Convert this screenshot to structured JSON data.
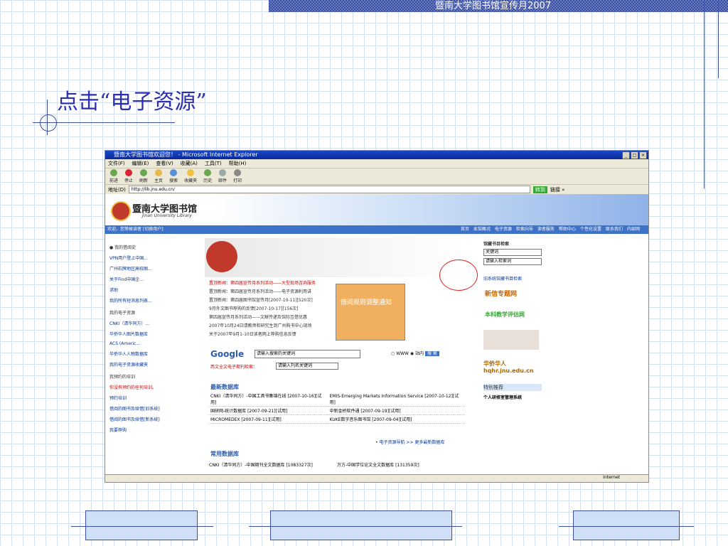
{
  "slide": {
    "header": "暨南大学图书馆宣传月2007",
    "title": "点击“电子资源”"
  },
  "browser": {
    "window_title": "暨南大学图书馆欢迎您！ - Microsoft Internet Explorer",
    "menu": [
      "文件(F)",
      "编辑(E)",
      "查看(V)",
      "收藏(A)",
      "工具(T)",
      "帮助(H)"
    ],
    "toolbar": [
      "前进",
      "停止",
      "刷新",
      "主页",
      "搜索",
      "收藏夹",
      "历史",
      "邮件",
      "打印"
    ],
    "address_label": "地址(D)",
    "url": "http://lib.jnu.edu.cn/",
    "go_label": "转到",
    "links_label": "链接 »",
    "status_zone": "Internet"
  },
  "site": {
    "name": "暨南大学图书馆",
    "subtitle": "Jinan University Library",
    "nav_left": "欢迎，您等候读者 [切换用户]",
    "nav_right": [
      "首页",
      "本馆概况",
      "电子资源",
      "检索向导",
      "读者服务",
      "帮助中心",
      "个性化设置",
      "联系我们",
      "内部网"
    ],
    "left_items": [
      "我的借阅史",
      "VPN用户登上中国...",
      "广州石牌地区高校图...",
      "关于Find中国企...",
      "求助",
      "我的所有短消息列表..."
    ],
    "left_head2": "我的电子资源",
    "left_items2": [
      "CNKI（清华同方）...",
      "华侨华人图片数据库",
      "ACS (Americ...",
      "华侨华人人物数据库",
      "我的电子资源收藏夹"
    ],
    "left_head3": "我预约的培训",
    "left_items3": [
      "你没有预约的任何培训。",
      "预约培训"
    ],
    "left_items4": [
      "借阅的图书及续借[旧系统]",
      "借阅的图书及续借[新系统]",
      "我要荐购"
    ],
    "news": [
      "置顶新闻：第四届宣传月系列活动——大型现场咨询服务",
      "置顶新闻：第四届宣传月系列活动——电子资源利用讲",
      "置顶新闻：第四届图书馆宣传月[2007-10-11][520次]",
      "9月外文图书荐购的反馈[2007-10-17][156次]",
      "第四届宣传月系列活动——文献传递及馆际互借优惠",
      "2007年10月24日请教师和研究生到广州购书中心现场",
      "关于2007年9月1-10日读者网上荐购信息反馈"
    ],
    "popup_title": "借阅规则调整通知",
    "google_label": "Google",
    "search_placeholder": "请输入搜索的关键词",
    "radio_www": "WWW",
    "radio_site": "站内",
    "search_btn": "搜 索",
    "journal_label": "西文全文电子期刊检索：",
    "journal_placeholder": "请输入刊名关键词",
    "new_db_title": "最新数据库",
    "new_db_rows": [
      [
        "CNKI（清华同方）-中国工具书集锦在线 [2007-10-16][试用]",
        "EMIS-Emerging Markets Information Service [2007-10-12][试用]"
      ],
      [
        "国研网-统计数据库 [2007-09-21][试用]",
        "中新金桥软件通 [2007-09-19][试用]"
      ],
      [
        "MICROMEDEX [2007-09-11][试用]",
        "KUKE数字音乐图书馆 [2007-09-04][试用]"
      ]
    ],
    "db_nav": "• 电子资源导航 >> 更多最新数据库",
    "common_db_title": "常用数据库",
    "common_db_row": [
      "CNKI（清华同方）-中国期刊全文数据库 [1083327次]",
      "万方-中国学位论文全文数据库 [131359次]"
    ],
    "right_title": "馆藏书目检索",
    "right_select": "关键词",
    "right_input": "请输入检索词",
    "right_link": "旧系统馆藏书目检索",
    "right_promo1": "新信专题网",
    "right_promo2": "本科教学评估网",
    "right_promo3": "华侨华人 hqhr.jnu.edu.cn",
    "right_box": "特别推荐",
    "right_box_item": "个人研修室管理系统"
  }
}
